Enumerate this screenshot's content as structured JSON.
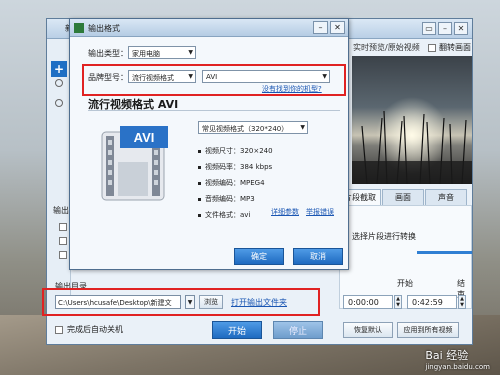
{
  "app": {
    "title": "新影",
    "preview_title": "实时预览/原始视频",
    "flip_label": "翻转画面",
    "out_label": "输出",
    "output_dir_label": "输出目录",
    "output_path": "C:\\Users\\hcusafe\\Desktop\\新建文",
    "browse_label": "浏览",
    "open_folder_label": "打开输出文件夹",
    "auto_shutdown_label": "完成后自动关机",
    "start_label": "开始",
    "stop_label": "停止",
    "tabs": [
      "片段截取",
      "画面",
      "声音"
    ],
    "select_text": "选择片段进行转换",
    "start_time_label": "开始",
    "end_time_label": "结束",
    "start_time": "0:00:00",
    "end_time": "0:42:59",
    "reset_label": "恢复默认",
    "apply_label": "应用到所有视频"
  },
  "dialog": {
    "title": "输出格式",
    "output_type_label": "输出类型：",
    "output_type_value": "家用电脑",
    "brand_label": "品牌型号：",
    "brand_value": "流行视频格式",
    "model_value": "AVI",
    "help_link": "没有找到你的机型?",
    "format_header": "流行视频格式 AVI",
    "preset_value": "常见视频格式（320*240）",
    "info": [
      "视频尺寸：320×240",
      "视频码率：384 kbps",
      "视频编码：MPEG4",
      "音频编码：MP3",
      "文件格式：avi"
    ],
    "detail_link": "详细参数",
    "compare_link": "举报错误",
    "ok_label": "确定",
    "cancel_label": "取消",
    "icon_text": "AVI"
  },
  "watermark": {
    "brand": "Bai 经验",
    "url": "jingyan.baidu.com"
  },
  "colors": {
    "accent": "#1e6ac0",
    "annotation": "#e02222"
  }
}
